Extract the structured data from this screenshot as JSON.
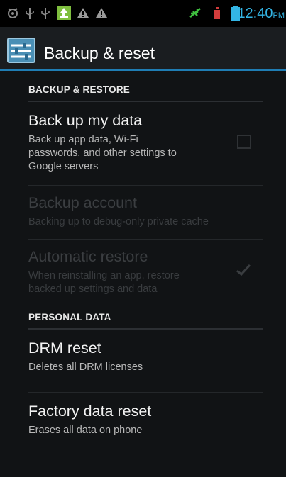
{
  "status_bar": {
    "time": "12:40",
    "ampm": "PM",
    "icons": [
      "android-debug-icon",
      "usb-icon",
      "usb-icon",
      "download-icon",
      "warning-icon",
      "warning-icon",
      "no-signal-icon",
      "no-sim-icon",
      "battery-icon"
    ]
  },
  "action_bar": {
    "title": "Backup & reset",
    "icon": "settings-app-icon"
  },
  "sections": {
    "backup_restore": {
      "header": "BACKUP & RESTORE",
      "back_up_my_data": {
        "title": "Back up my data",
        "summary_lines": [
          "Back up app data, Wi-Fi",
          "passwords, and other settings to",
          "Google servers"
        ],
        "checked": false
      },
      "backup_account": {
        "title": "Backup account",
        "summary": "Backing up to debug-only private cache",
        "enabled": false
      },
      "automatic_restore": {
        "title": "Automatic restore",
        "summary_lines": [
          "When reinstalling an app, restore",
          "backed up settings and data"
        ],
        "checked": true,
        "enabled": false
      }
    },
    "personal_data": {
      "header": "PERSONAL DATA",
      "drm_reset": {
        "title": "DRM reset",
        "summary": "Deletes all DRM licenses"
      },
      "factory_data_reset": {
        "title": "Factory data reset",
        "summary": "Erases all data on phone"
      }
    }
  },
  "colors": {
    "accent": "#33b5e5",
    "action_bar_divider": "#1f7db4",
    "background": "#111315",
    "usb_green": "#7fbf3f",
    "no_signal_green": "#3fbf3f",
    "no_sim_red": "#d23c3c"
  }
}
